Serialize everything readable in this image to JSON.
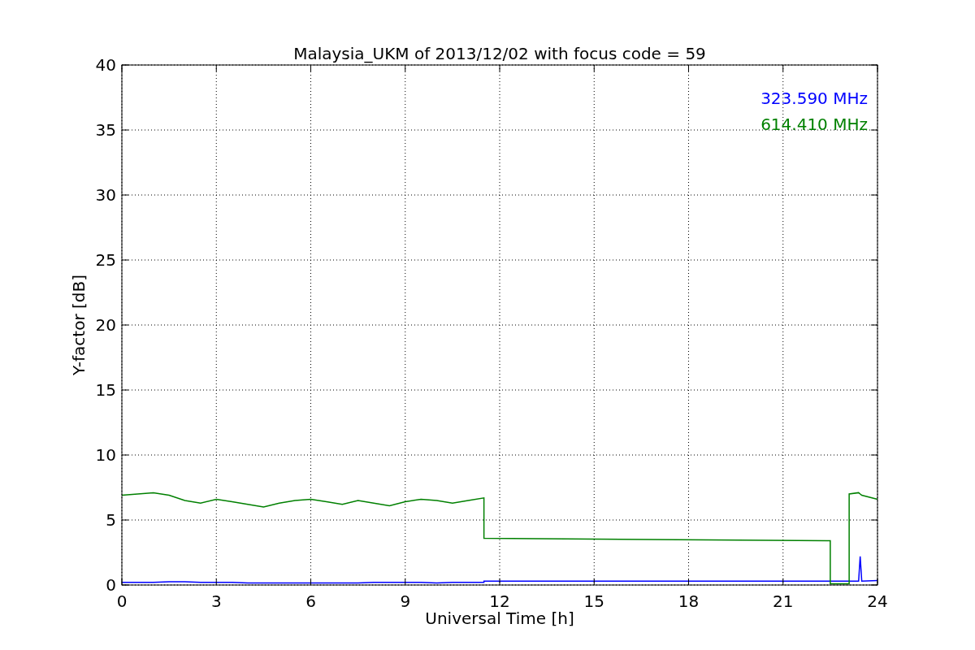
{
  "chart_data": {
    "type": "line",
    "title": "Malaysia_UKM of 2013/12/02 with focus code = 59",
    "xlabel": "Universal Time [h]",
    "ylabel": "Y-factor [dB]",
    "x": [
      0,
      0.5,
      1,
      1.5,
      2,
      2.5,
      3,
      3.5,
      4,
      4.5,
      5,
      5.5,
      6,
      6.5,
      7,
      7.5,
      8,
      8.5,
      9,
      9.5,
      10,
      10.5,
      11,
      11.5,
      11.5,
      22.5,
      22.5,
      23.1,
      23.1,
      23.4,
      23.45,
      23.5,
      24
    ],
    "series": [
      {
        "name": "323.590 MHz",
        "color": "#0000ff",
        "values": [
          0.2,
          0.2,
          0.2,
          0.25,
          0.25,
          0.2,
          0.2,
          0.2,
          0.15,
          0.15,
          0.15,
          0.15,
          0.15,
          0.15,
          0.15,
          0.15,
          0.2,
          0.2,
          0.2,
          0.2,
          0.15,
          0.2,
          0.2,
          0.2,
          0.3,
          0.3,
          0.3,
          0.3,
          0.3,
          0.3,
          2.2,
          0.3,
          0.35
        ]
      },
      {
        "name": "614.410 MHz",
        "color": "#008000",
        "values": [
          6.9,
          7.0,
          7.1,
          6.9,
          6.5,
          6.3,
          6.6,
          6.4,
          6.2,
          6.0,
          6.3,
          6.5,
          6.6,
          6.4,
          6.2,
          6.5,
          6.3,
          6.1,
          6.4,
          6.6,
          6.5,
          6.3,
          6.5,
          6.7,
          3.6,
          3.4,
          0.1,
          0.1,
          7.0,
          7.1,
          7.0,
          6.9,
          6.6
        ]
      }
    ],
    "grid": true,
    "xlim": [
      0,
      24
    ],
    "ylim": [
      0,
      40
    ],
    "xticks": [
      0,
      3,
      6,
      9,
      12,
      15,
      18,
      21,
      24
    ],
    "yticks": [
      0,
      5,
      10,
      15,
      20,
      25,
      30,
      35,
      40
    ]
  }
}
